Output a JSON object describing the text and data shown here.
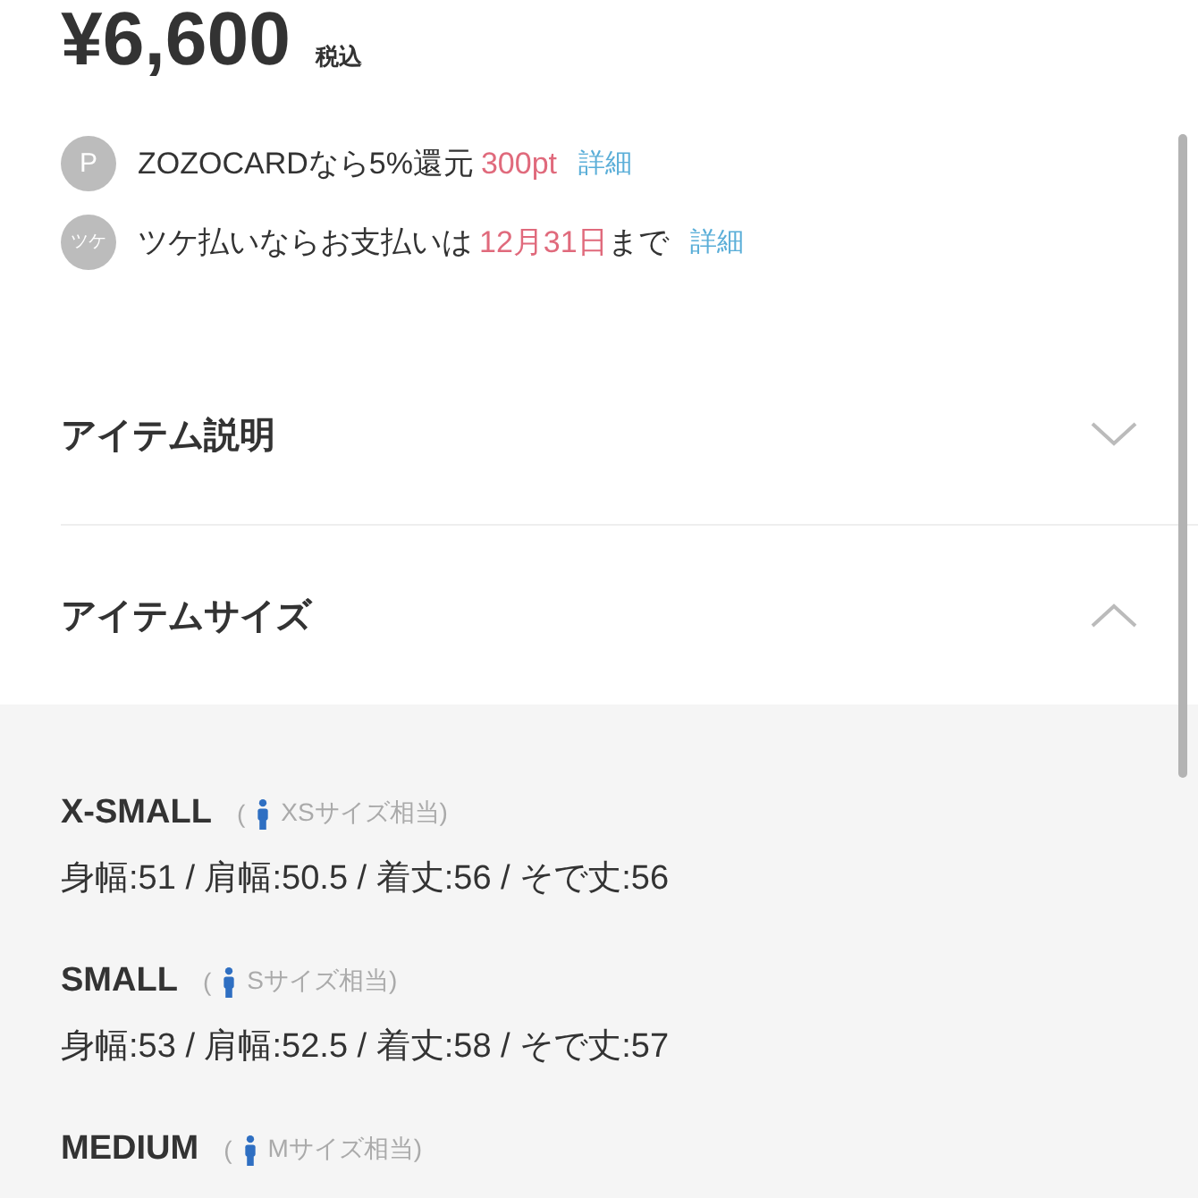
{
  "price": {
    "amount": "¥6,600",
    "tax_label": "税込"
  },
  "benefits": [
    {
      "icon_text": "P",
      "segments": [
        {
          "text": "ZOZOCARDなら5%還元",
          "kind": "plain"
        },
        {
          "text": "300pt",
          "kind": "highlight"
        }
      ],
      "link": "詳細"
    },
    {
      "icon_text": "ツケ",
      "segments": [
        {
          "text": "ツケ払いならお支払いは",
          "kind": "plain"
        },
        {
          "text": "12月31日",
          "kind": "highlight"
        },
        {
          "text": "まで",
          "kind": "plain"
        }
      ],
      "link": "詳細"
    }
  ],
  "sections": [
    {
      "title": "アイテム説明",
      "expanded": false
    },
    {
      "title": "アイテムサイズ",
      "expanded": true
    }
  ],
  "sizes": [
    {
      "name": "X-SMALL",
      "note_open": "(",
      "note": "XSサイズ相当)",
      "measurements": "身幅:51 / 肩幅:50.5 / 着丈:56 / そで丈:56"
    },
    {
      "name": "SMALL",
      "note_open": "(",
      "note": "Sサイズ相当)",
      "measurements": "身幅:53 / 肩幅:52.5 / 着丈:58 / そで丈:57"
    },
    {
      "name": "MEDIUM",
      "note_open": "(",
      "note": "Mサイズ相当)"
    }
  ]
}
